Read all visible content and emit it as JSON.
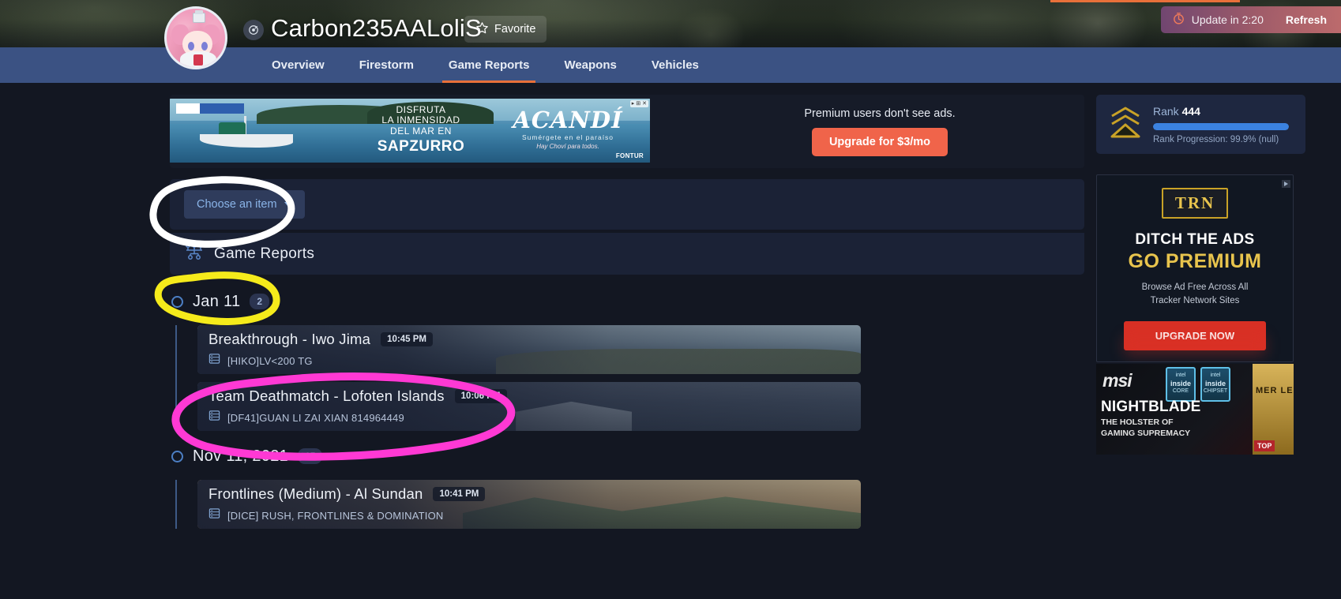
{
  "header": {
    "profile_name": "Carbon235AALoliS",
    "verified_icon": "platform-icon",
    "favorite_label": "Favorite",
    "favorite_icon": "star-icon",
    "update_label": "Update in 2:20",
    "update_icon": "timer-icon",
    "refresh_label": "Refresh",
    "avatar_icon": "user-avatar"
  },
  "nav": {
    "items": [
      {
        "label": "Overview",
        "active": false
      },
      {
        "label": "Firestorm",
        "active": false
      },
      {
        "label": "Game Reports",
        "active": true
      },
      {
        "label": "Weapons",
        "active": false
      },
      {
        "label": "Vehicles",
        "active": false
      }
    ]
  },
  "ad_banner": {
    "line1": "DISFRUTA",
    "line2": "LA INMENSIDAD",
    "line3": "DEL MAR EN",
    "line4": "SAPZURRO",
    "brand": "ACANDÍ",
    "tagline": "Sumérgete en el paraíso",
    "script": "Hay Choví para todos.",
    "sponsor": "FONTUR",
    "controls": [
      "adchoices-icon",
      "info-icon",
      "close-icon"
    ]
  },
  "premium": {
    "text": "Premium users don't see ads.",
    "button_label": "Upgrade for $3/mo",
    "button_color": "#f0644a"
  },
  "filter": {
    "dropdown_label": "Choose an item",
    "dropdown_icon": "chevron-down-icon"
  },
  "section": {
    "title": "Game Reports",
    "icon": "sitemap-icon"
  },
  "timeline": [
    {
      "date": "Jan 11",
      "count": "2",
      "matches": [
        {
          "title": "Breakthrough - Iwo Jima",
          "time": "10:45 PM",
          "server": "[HIKO]LV<200 TG",
          "server_icon": "server-icon",
          "map_class": "map-iwo"
        },
        {
          "title": "Team Deathmatch - Lofoten Islands",
          "time": "10:06 PM",
          "server": "[DF41]GUAN LI ZAI XIAN 814964449",
          "server_icon": "server-icon",
          "map_class": "map-lofoten"
        }
      ]
    },
    {
      "date": "Nov 11, 2021",
      "count": "15",
      "matches": [
        {
          "title": "Frontlines (Medium) - Al Sundan",
          "time": "10:41 PM",
          "server": "[DICE] RUSH, FRONTLINES & DOMINATION",
          "server_icon": "server-icon",
          "map_class": "map-sundan"
        }
      ]
    }
  ],
  "rank_card": {
    "label": "Rank",
    "value": "444",
    "progress_text": "Rank Progression: 99.9% (null)",
    "progress_percent": 99.9,
    "badge_icon": "rank-chevron-icon",
    "bar_color": "#3b82e0"
  },
  "trn_ad": {
    "logo": "TRN",
    "line1": "DITCH THE ADS",
    "line2": "GO PREMIUM",
    "sub1": "Browse Ad Free Across All",
    "sub2": "Tracker Network Sites",
    "cta": "UPGRADE NOW"
  },
  "msi_ad": {
    "brand": "msi",
    "title": "NIGHTBLADE",
    "sub1": "THE HOLSTER OF",
    "sub2": "GAMING SUPREMACY",
    "chip1_top": "intel",
    "chip1_mid": "inside",
    "chip1_bot": "CORE",
    "chip2_top": "intel",
    "chip2_mid": "inside",
    "chip2_bot": "CHIPSET",
    "right_text": "MER LE",
    "right_badge": "TOP"
  },
  "annotations": [
    {
      "id": "white-ellipse",
      "color": "#ffffff",
      "target": "choose-an-item dropdown"
    },
    {
      "id": "yellow-ellipse",
      "color": "#f5eb1b",
      "target": "Jan 11 date row"
    },
    {
      "id": "pink-ellipse",
      "color": "#ff39d4",
      "target": "Team Deathmatch - Lofoten Islands match"
    }
  ]
}
